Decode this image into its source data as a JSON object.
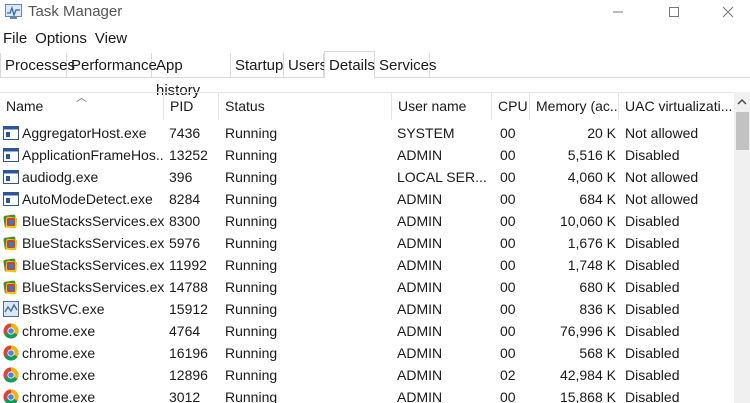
{
  "window": {
    "title": "Task Manager"
  },
  "menu": [
    "File",
    "Options",
    "View"
  ],
  "tabs": [
    {
      "label": "Processes"
    },
    {
      "label": "Performance"
    },
    {
      "label": "App history"
    },
    {
      "label": "Startup"
    },
    {
      "label": "Users"
    },
    {
      "label": "Details",
      "active": true
    },
    {
      "label": "Services"
    }
  ],
  "columns": {
    "name": "Name",
    "pid": "PID",
    "status": "Status",
    "user": "User name",
    "cpu": "CPU",
    "memory": "Memory (ac...",
    "uac": "UAC virtualizati..."
  },
  "rows": [
    {
      "icon": "app-window-icon",
      "name": "AggregatorHost.exe",
      "pid": "7436",
      "status": "Running",
      "user": "SYSTEM",
      "cpu": "00",
      "memory": "20 K",
      "uac": "Not allowed"
    },
    {
      "icon": "app-window-icon",
      "name": "ApplicationFrameHos...",
      "pid": "13252",
      "status": "Running",
      "user": "ADMIN",
      "cpu": "00",
      "memory": "5,516 K",
      "uac": "Disabled"
    },
    {
      "icon": "app-window-icon",
      "name": "audiodg.exe",
      "pid": "396",
      "status": "Running",
      "user": "LOCAL SER...",
      "cpu": "00",
      "memory": "4,060 K",
      "uac": "Not allowed"
    },
    {
      "icon": "app-window-icon",
      "name": "AutoModeDetect.exe",
      "pid": "8284",
      "status": "Running",
      "user": "ADMIN",
      "cpu": "00",
      "memory": "684 K",
      "uac": "Not allowed"
    },
    {
      "icon": "bluestacks-icon",
      "name": "BlueStacksServices.exe",
      "pid": "8300",
      "status": "Running",
      "user": "ADMIN",
      "cpu": "00",
      "memory": "10,060 K",
      "uac": "Disabled"
    },
    {
      "icon": "bluestacks-icon",
      "name": "BlueStacksServices.exe",
      "pid": "5976",
      "status": "Running",
      "user": "ADMIN",
      "cpu": "00",
      "memory": "1,676 K",
      "uac": "Disabled"
    },
    {
      "icon": "bluestacks-icon",
      "name": "BlueStacksServices.exe",
      "pid": "11992",
      "status": "Running",
      "user": "ADMIN",
      "cpu": "00",
      "memory": "1,748 K",
      "uac": "Disabled"
    },
    {
      "icon": "bluestacks-icon",
      "name": "BlueStacksServices.exe",
      "pid": "14788",
      "status": "Running",
      "user": "ADMIN",
      "cpu": "00",
      "memory": "680 K",
      "uac": "Disabled"
    },
    {
      "icon": "bstk-icon",
      "name": "BstkSVC.exe",
      "pid": "15912",
      "status": "Running",
      "user": "ADMIN",
      "cpu": "00",
      "memory": "836 K",
      "uac": "Disabled"
    },
    {
      "icon": "chrome-icon",
      "name": "chrome.exe",
      "pid": "4764",
      "status": "Running",
      "user": "ADMIN",
      "cpu": "00",
      "memory": "76,996 K",
      "uac": "Disabled"
    },
    {
      "icon": "chrome-icon",
      "name": "chrome.exe",
      "pid": "16196",
      "status": "Running",
      "user": "ADMIN",
      "cpu": "00",
      "memory": "568 K",
      "uac": "Disabled"
    },
    {
      "icon": "chrome-icon",
      "name": "chrome.exe",
      "pid": "12896",
      "status": "Running",
      "user": "ADMIN",
      "cpu": "02",
      "memory": "42,984 K",
      "uac": "Disabled"
    },
    {
      "icon": "chrome-icon",
      "name": "chrome.exe",
      "pid": "3012",
      "status": "Running",
      "user": "ADMIN",
      "cpu": "00",
      "memory": "15,868 K",
      "uac": "Disabled"
    }
  ]
}
